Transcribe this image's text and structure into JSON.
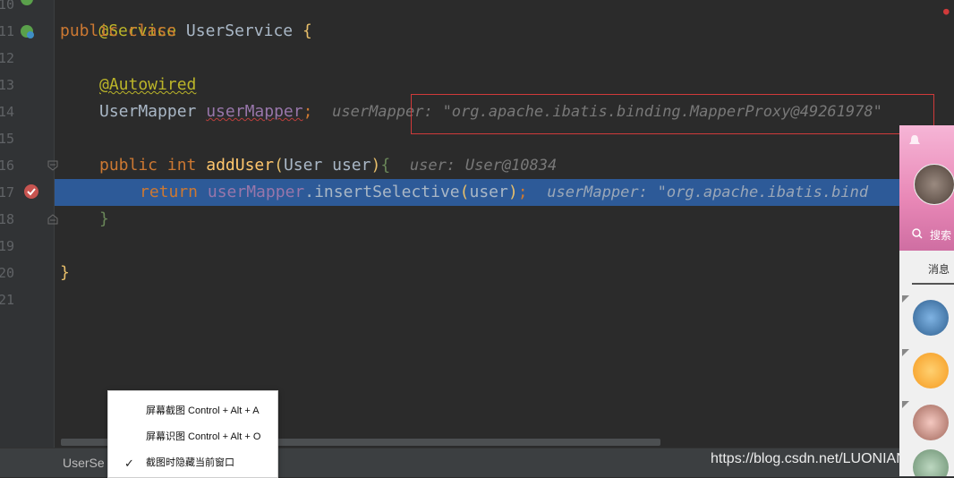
{
  "colors": {
    "editor_bg": "#2b2b2b",
    "highlight": "#2d5a98",
    "keyword": "#cc7832",
    "annotation": "#bbb529",
    "field": "#9876aa",
    "method": "#ffc66d",
    "hint": "#787878",
    "box": "#d03a3a"
  },
  "gutter": {
    "line_numbers": [
      "10",
      "11",
      "12",
      "13",
      "14",
      "15",
      "16",
      "17",
      "18",
      "19",
      "20",
      "21"
    ]
  },
  "code": {
    "l10": "@Service",
    "l11_kw1": "public",
    "l11_kw2": "class",
    "l11_name": "UserService",
    "l11_brace": "{",
    "l13_ann": "@Autowired",
    "l14_type": "UserMapper",
    "l14_field": "userMapper",
    "l14_semi": ";",
    "l14_hint_label": "userMapper:",
    "l14_hint_value": "\"org.apache.ibatis.binding.MapperProxy@49261978\"",
    "l16_kw1": "public",
    "l16_kw2": "int",
    "l16_method": "addUser",
    "l16_params": "User user",
    "l16_brace": "{",
    "l16_hint_label": "user:",
    "l16_hint_value": "User@10834",
    "l17_kw": "return",
    "l17_field": "userMapper",
    "l17_call": ".insertSelective",
    "l17_arg": "user",
    "l17_semi": ";",
    "l17_hint_label": "userMapper:",
    "l17_hint_value": "\"org.apache.ibatis.bind",
    "l18_brace": "}",
    "l20_brace": "}"
  },
  "context_menu": {
    "items": [
      {
        "label": "屏幕截图 Control + Alt + A",
        "checked": false
      },
      {
        "label": "屏幕识图 Control + Alt + O",
        "checked": false
      },
      {
        "label": "截图时隐藏当前窗口",
        "checked": true
      }
    ],
    "check_glyph": "✓"
  },
  "statusbar": {
    "file_label": "UserSe"
  },
  "watermark": "https://blog.csdn.net/LUONIANXING",
  "side_panel": {
    "search_label": "搜索",
    "tab_label": "消息"
  },
  "icons": {
    "breakpoint": "breakpoint-icon",
    "bean": "spring-bean-icon",
    "fold": "fold-icon",
    "error": "error-stripe-icon"
  }
}
